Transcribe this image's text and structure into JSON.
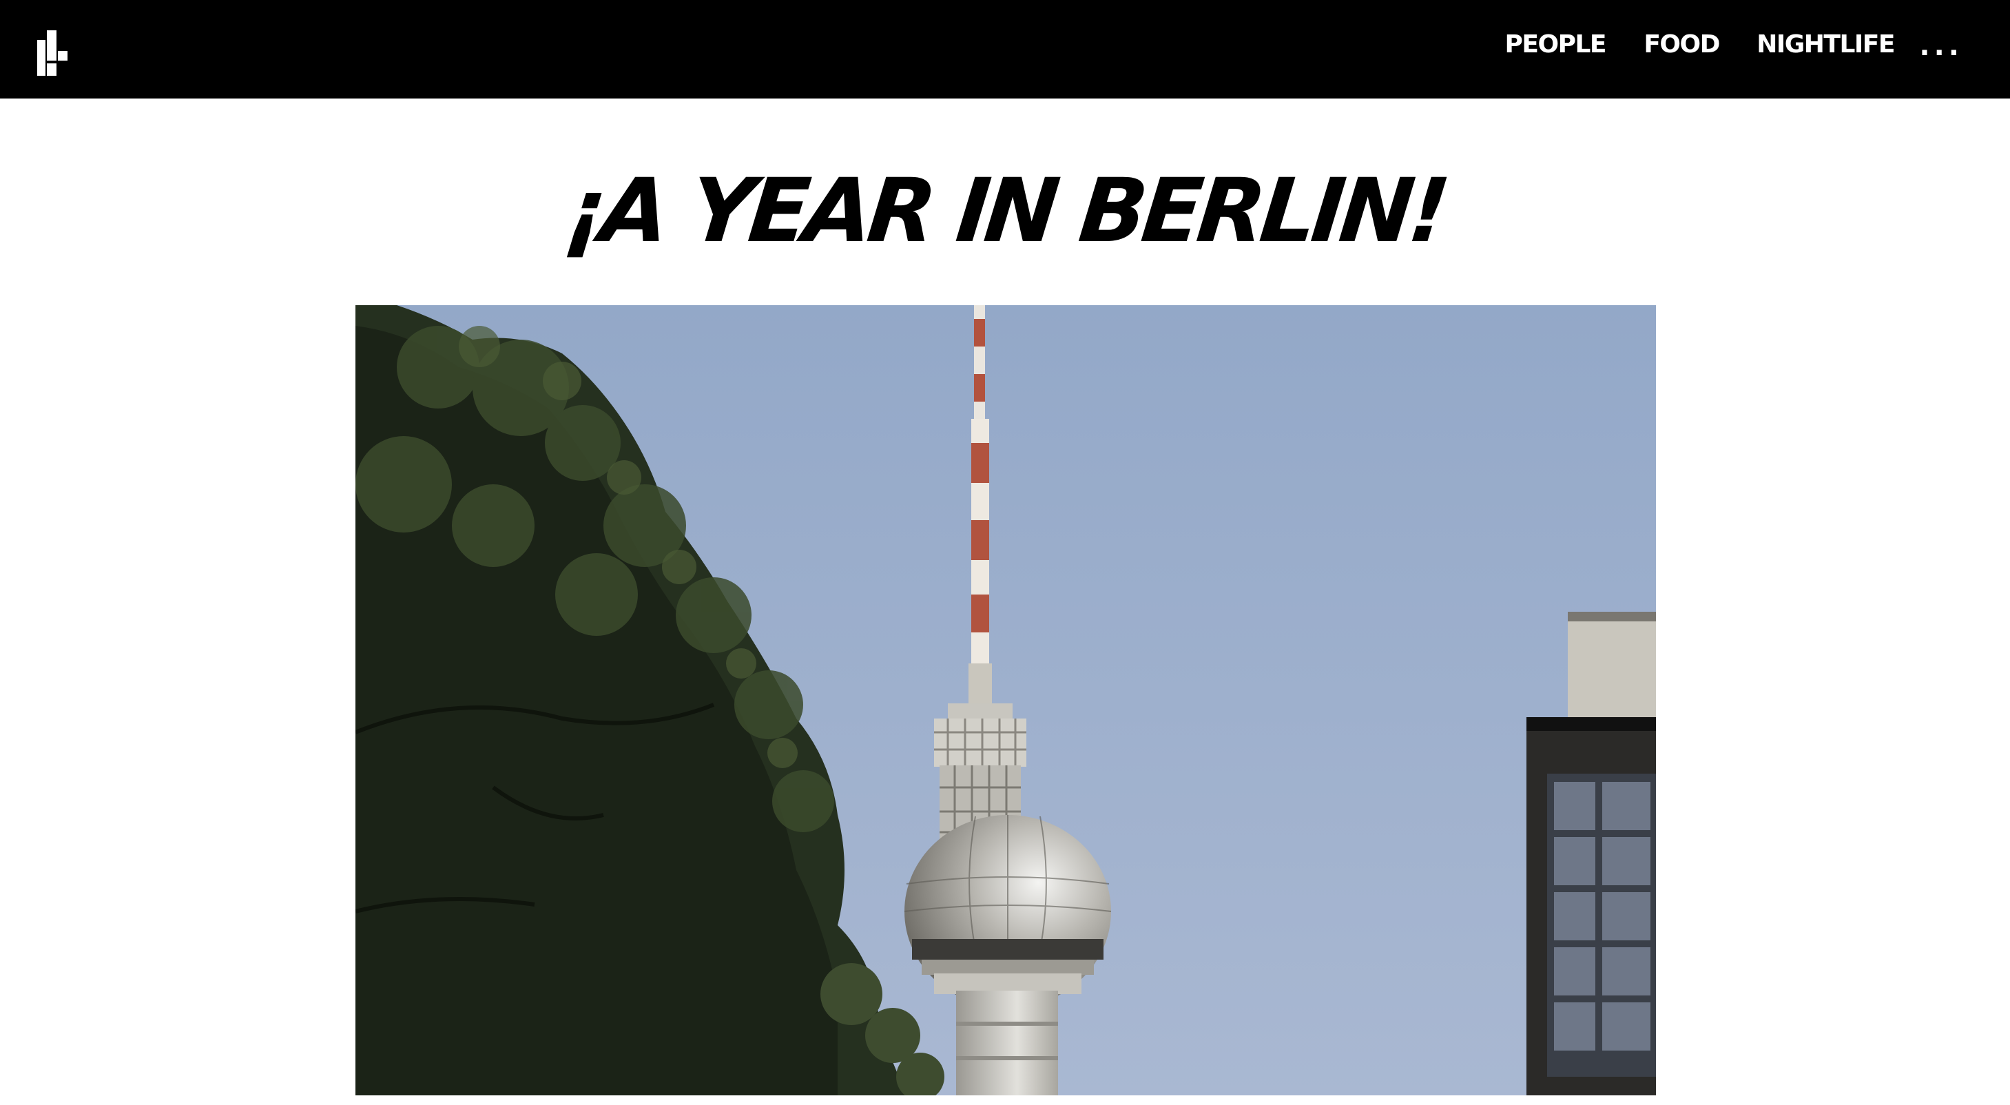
{
  "header": {
    "logo_icon": "site-logo-icon",
    "nav": {
      "people_label": "PEOPLE",
      "food_label": "FOOD",
      "nightlife_label": "NIGHTLIFE",
      "more_label": "..."
    }
  },
  "main": {
    "title": "¡A YEAR IN BERLIN!",
    "hero_image": {
      "icon": "berlin-tv-tower-photo"
    }
  },
  "colors": {
    "header_bg": "#000000",
    "header_text": "#ffffff",
    "page_bg": "#ffffff",
    "title_text": "#000000"
  }
}
